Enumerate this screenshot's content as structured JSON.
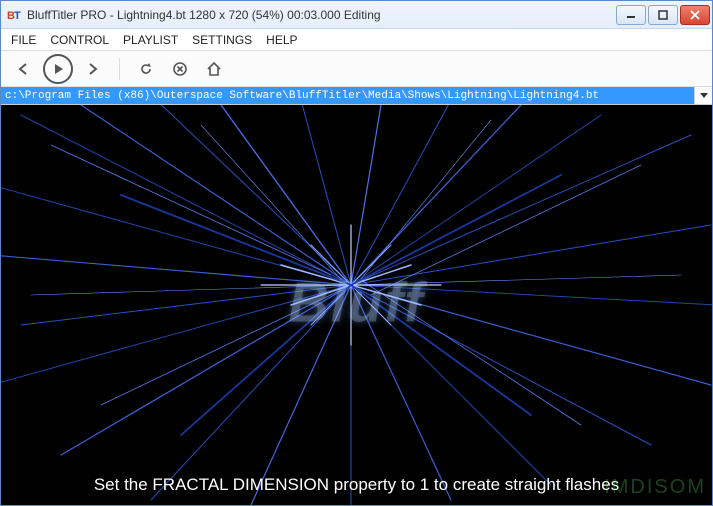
{
  "titlebar": {
    "app_icon_label": "BT",
    "title": "BluffTitler PRO  - Lightning4.bt 1280 x 720 (54%) 00:03.000 Editing"
  },
  "menubar": {
    "items": [
      "FILE",
      "CONTROL",
      "PLAYLIST",
      "SETTINGS",
      "HELP"
    ]
  },
  "toolbar": {
    "back": "back",
    "play": "play",
    "forward": "forward",
    "reload": "reload",
    "stop": "stop",
    "home": "home"
  },
  "pathbar": {
    "path": "c:\\Program Files (x86)\\Outerspace Software\\BluffTitler\\Media\\Shows\\Lightning\\Lightning4.bt"
  },
  "viewport": {
    "center_text": "Bluff",
    "caption": "Set the FRACTAL DIMENSION property to 1 to create straight flashes",
    "watermark": "IMDISOM"
  }
}
